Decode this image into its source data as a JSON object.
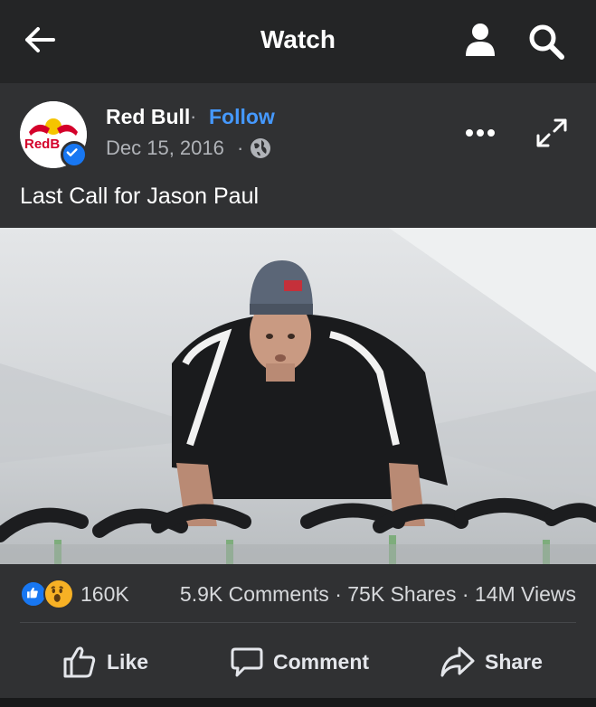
{
  "header": {
    "title": "Watch",
    "back_icon": "arrow-left-icon",
    "profile_icon": "person-icon",
    "search_icon": "search-icon"
  },
  "post": {
    "author": "Red Bull",
    "separator": "·",
    "follow_label": "Follow",
    "date": "Dec 15, 2016",
    "privacy_icon": "globe-icon",
    "caption": "Last Call for Jason Paul",
    "avatar_text": "Red Bull"
  },
  "stats": {
    "reaction_count": "160K",
    "comments": "5.9K Comments",
    "shares": "75K Shares",
    "views": "14M Views",
    "dot": "·"
  },
  "actions": {
    "like": "Like",
    "comment": "Comment",
    "share": "Share"
  },
  "colors": {
    "background": "#242526",
    "card": "#303133",
    "accent": "#4599ff",
    "like_blue": "#1877f2",
    "wow_yellow": "#f7b125"
  }
}
